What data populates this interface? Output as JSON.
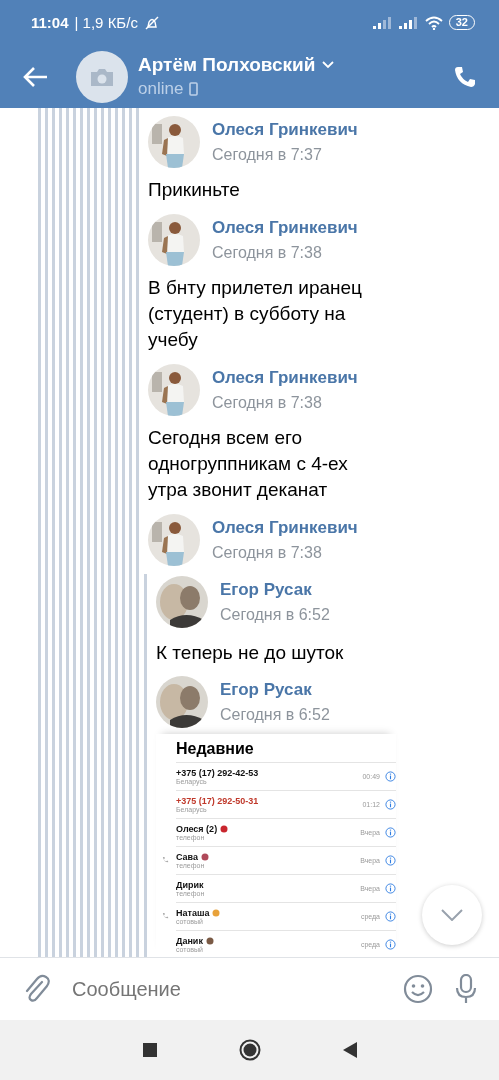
{
  "status_bar": {
    "time": "11:04",
    "speed": "| 1,9 КБ/с",
    "battery": "32"
  },
  "header": {
    "name": "Артём Полховский",
    "status": "online"
  },
  "messages": [
    {
      "author": "Олеся Гринкевич",
      "time": "Сегодня в 7:37",
      "text": "Прикиньте"
    },
    {
      "author": "Олеся Гринкевич",
      "time": "Сегодня в 7:38",
      "text": "В бнту прилетел иранец (студент) в субботу на учебу"
    },
    {
      "author": "Олеся Гринкевич",
      "time": "Сегодня в 7:38",
      "text": "Сегодня всем его одногруппникам с 4-ех утра звонит деканат"
    },
    {
      "author": "Олеся Гринкевич",
      "time": "Сегодня в 7:38"
    }
  ],
  "forwarded": {
    "messages": [
      {
        "author": "Егор Русак",
        "time": "Сегодня в 6:52",
        "text": "К теперь не до шуток"
      },
      {
        "author": "Егор Русак",
        "time": "Сегодня в 6:52"
      }
    ],
    "attachment": {
      "title": "Недавние",
      "rows": [
        {
          "name": "+375 (17) 292-42-53",
          "sub": "Беларусь",
          "time": "00:49",
          "missed": false,
          "call_icon": false
        },
        {
          "name": "+375 (17) 292-50-31",
          "sub": "Беларусь",
          "time": "01:12",
          "missed": true,
          "call_icon": false
        },
        {
          "name": "Олеся (2)",
          "sub": "телефон",
          "time": "Вчера",
          "missed": false,
          "call_icon": false
        },
        {
          "name": "Сава",
          "sub": "телефон",
          "time": "Вчера",
          "missed": false,
          "call_icon": true
        },
        {
          "name": "Дирик",
          "sub": "телефон",
          "time": "Вчера",
          "missed": false,
          "call_icon": false
        },
        {
          "name": "Наташа",
          "sub": "сотовый",
          "time": "среда",
          "missed": false,
          "call_icon": true
        },
        {
          "name": "Даник",
          "sub": "сотовый",
          "time": "среда",
          "missed": false,
          "call_icon": false
        }
      ]
    }
  },
  "composer": {
    "placeholder": "Сообщение"
  }
}
